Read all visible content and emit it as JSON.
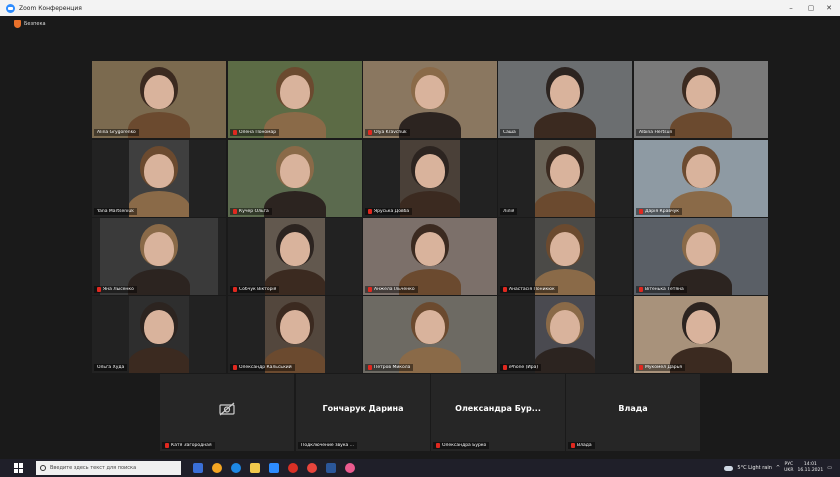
{
  "window": {
    "title": "Zoom Конференция",
    "minimize": "–",
    "maximize": "▢",
    "close": "✕"
  },
  "meeting": {
    "security_label": "Безпека",
    "gallery": [
      {
        "name": "Alina Grygorenko",
        "muted": false,
        "active": true
      },
      {
        "name": "Олена Пономар",
        "muted": true
      },
      {
        "name": "Olya Kravchuk",
        "muted": true
      },
      {
        "name": "Саша",
        "muted": false
      },
      {
        "name": "Albina Hertsun",
        "muted": false
      },
      {
        "name": "Yana Martseniuk",
        "muted": false
      },
      {
        "name": "Кучер Ольга",
        "muted": true
      },
      {
        "name": "Яруська Довба",
        "muted": true
      },
      {
        "name": "Лілія",
        "muted": false
      },
      {
        "name": "Дарія Кравчук",
        "muted": true
      },
      {
        "name": "Яна Лысенко",
        "muted": true
      },
      {
        "name": "Собчук Вікторія",
        "muted": true
      },
      {
        "name": "Анжела Ільченко",
        "muted": true
      },
      {
        "name": "Анастасія Поникюк",
        "muted": true
      },
      {
        "name": "Вітенька Тетяна",
        "muted": true
      },
      {
        "name": "Ольга Худа",
        "muted": false
      },
      {
        "name": "Олександр Кальський",
        "muted": true
      },
      {
        "name": "Петров Микола",
        "muted": true
      },
      {
        "name": "iPhone (Ира)",
        "muted": true
      },
      {
        "name": "Мукомел Дарья",
        "muted": true
      }
    ],
    "bottom_row": [
      {
        "big_name": "",
        "name": "Катя Загородная",
        "muted": true,
        "camera_off_icon": true
      },
      {
        "big_name": "Гончарук Дарина",
        "name": "Подключение звука ...",
        "muted": false
      },
      {
        "big_name": "Олександра Бур...",
        "name": "Олександра Бурко",
        "muted": true
      },
      {
        "big_name": "Влада",
        "name": "Влада",
        "muted": true
      }
    ]
  },
  "taskbar": {
    "search_placeholder": "Введите здесь текст для поиска",
    "weather": "5°C Light rain",
    "lang": "РУС",
    "lang2": "UKR",
    "time": "14:01",
    "date": "16.11.2021"
  },
  "colors": {
    "accent_active": "#c9f25a",
    "mute_red": "#e0281f",
    "zoom_blue": "#2d8cff"
  }
}
